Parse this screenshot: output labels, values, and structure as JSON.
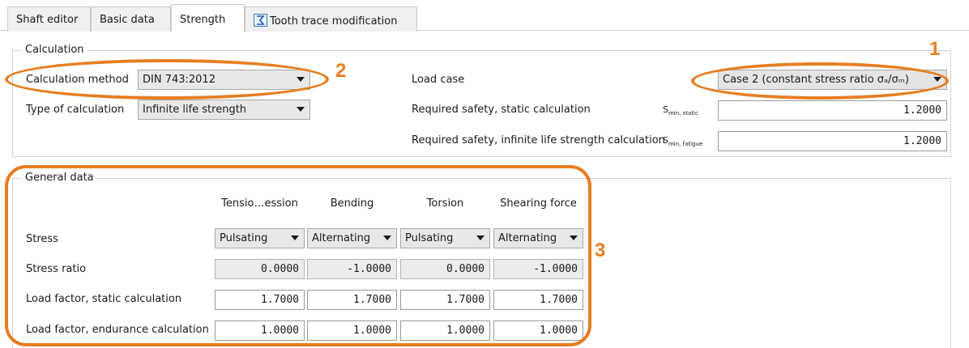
{
  "tabs": [
    {
      "label": "Shaft editor"
    },
    {
      "label": "Basic data"
    },
    {
      "label": "Strength"
    },
    {
      "label": "Tooth trace modification"
    }
  ],
  "calculation": {
    "group_title": "Calculation",
    "method_label": "Calculation method",
    "method_value": "DIN 743:2012",
    "type_label": "Type of calculation",
    "type_value": "Infinite life strength",
    "load_case_label": "Load case",
    "load_case_value": "Case 2 (constant stress ratio σₐ/σₘ)",
    "req_static_label": "Required safety, static calculation",
    "req_static_sym": "S",
    "req_static_sub": "min, static",
    "req_static_value": "1.2000",
    "req_fatigue_label": "Required safety, infinite life strength calculation",
    "req_fatigue_sym": "S",
    "req_fatigue_sub": "min, fatigue",
    "req_fatigue_value": "1.2000"
  },
  "general": {
    "group_title": "General data",
    "columns": [
      "Tensio…ession",
      "Bending",
      "Torsion",
      "Shearing force"
    ],
    "stress_label": "Stress",
    "stress_values": [
      "Pulsating",
      "Alternating",
      "Pulsating",
      "Alternating"
    ],
    "ratio_label": "Stress ratio",
    "ratio_values": [
      "0.0000",
      "-1.0000",
      "0.0000",
      "-1.0000"
    ],
    "static_label": "Load factor, static calculation",
    "static_values": [
      "1.7000",
      "1.7000",
      "1.7000",
      "1.7000"
    ],
    "endurance_label": "Load factor, endurance calculation",
    "endurance_values": [
      "1.0000",
      "1.0000",
      "1.0000",
      "1.0000"
    ]
  },
  "annotations": [
    "1",
    "2",
    "3"
  ],
  "colors": {
    "annotation": "#e67e22"
  }
}
